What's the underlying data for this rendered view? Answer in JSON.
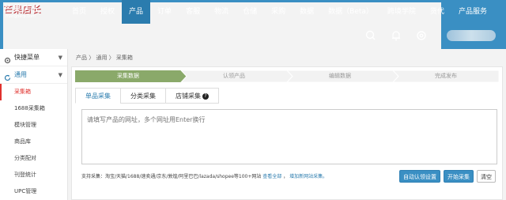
{
  "logo": {
    "name": "芒果店长",
    "domain": "mangoerp.com"
  },
  "nav": {
    "items": [
      "首页",
      "授权",
      "产品",
      "订单",
      "客服",
      "物流",
      "仓储",
      "采购",
      "数据",
      "数据（Beta）",
      "跨境学院",
      "货代",
      "产品服务"
    ],
    "active_index": 2,
    "icons": [
      "search-icon",
      "bell-icon",
      "settings-icon"
    ]
  },
  "sidebar": {
    "quick_menu": "快捷菜单",
    "general": "通用",
    "items": [
      "采集箱",
      "1688采集箱",
      "模块管理",
      "商品库",
      "分类配对",
      "刊登统计",
      "UPC管理"
    ],
    "active_index": 0
  },
  "breadcrumb": "产品 〉 通用 〉 采集箱",
  "steps": [
    "采集数据",
    "认领产品",
    "编辑数据",
    "完成发布"
  ],
  "tabs": {
    "items": [
      "单品采集",
      "分类采集",
      "店铺采集"
    ],
    "active_index": 0,
    "help_glyph": "?"
  },
  "url_input": {
    "placeholder": "请填写产品的网址，多个网址用Enter换行"
  },
  "support": {
    "text": "支持采集：淘宝/天猫/1688/速卖通/京东/敦煌/阿里巴巴/lazada/shopee等100+网站",
    "view_all": "查看全部",
    "add_site": "增加新网站采集。"
  },
  "buttons": {
    "auto_claim": "自动认领设置",
    "start": "开始采集",
    "clear": "清空"
  },
  "colors": {
    "brand": "#3a8fc3",
    "active_step": "#8aa96a",
    "accent_red": "#e0312d"
  }
}
